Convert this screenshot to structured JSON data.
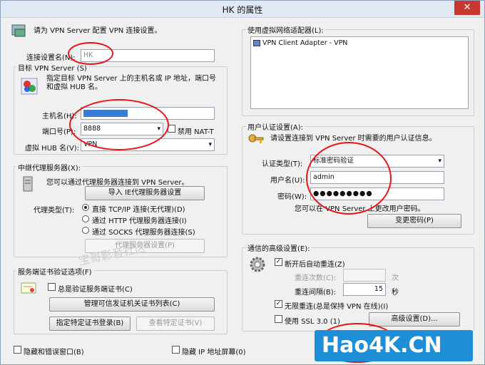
{
  "window": {
    "title": "HK 的属性",
    "close_label": "✕"
  },
  "intro": {
    "text": "请为 VPN Server 配置 VPN 连接设置。"
  },
  "connection": {
    "name_label": "连接设置名(N):",
    "name_value": "HK"
  },
  "target": {
    "group_label": "目标 VPN Server (S)",
    "desc": "指定目标 VPN Server 上的主机名或 IP 地址，端口号和虚拟 HUB 名。",
    "host_label": "主机名(H):",
    "port_label": "端口号(P):",
    "port_value": "8888",
    "nat_t_label": "禁用 NAT-T",
    "hub_label": "虚拟 HUB 名(V):",
    "hub_value": "VPN"
  },
  "proxy": {
    "group_label": "中继代理服务器(X):",
    "desc": "您可以通过代理服务器连接到 VPN Server。",
    "import_button": "导入 IE代理服务器设置",
    "type_label": "代理类型(T):",
    "options": [
      "直接 TCP/IP 连接(无代理)(D)",
      "通过 HTTP 代理服务器连接(I)",
      "通过 SOCKS 代理服务器连接(S)"
    ],
    "settings_button": "代理服务器设置(P)"
  },
  "cert": {
    "group_label": "服务端证书验证选项(F)",
    "verify_label": "总是验证服务端证书(C)",
    "manage_button": "管理可信发证机关证书列表(C)",
    "specify_button": "指定特定证书登录(B)",
    "view_button": "查看特定证书(V)"
  },
  "adapter": {
    "group_label": "使用虚拟网络适配器(L):",
    "item": "VPN Client Adapter - VPN"
  },
  "auth": {
    "group_label": "用户认证设置(A):",
    "desc": "请设置连接到 VPN Server 时需要的用户认证信息。",
    "type_label": "认证类型(T):",
    "type_value": "标准密码验证",
    "user_label": "用户名(U):",
    "user_value": "admin",
    "pass_label": "密码(W):",
    "pass_value": "●●●●●●●●●",
    "hint": "您可以在 VPN Server 上更改用户密码。",
    "change_button": "变更密码(P)"
  },
  "advanced": {
    "group_label": "通信的高级设置(E):",
    "auto_reconnect": "断开后自动重连(Z)",
    "retry_label": "重连次数(C):",
    "retry_unit": "次",
    "interval_label": "重连间隔(B):",
    "interval_value": "15",
    "interval_unit": "秒",
    "infinite": "无限重连(总是保持 VPN 在线)(I)",
    "ssl_label": "使用 SSL 3.0 (1)",
    "settings_button": "高级设置(D)..."
  },
  "bottom": {
    "hide_status": "隐藏和错误窗口(B)",
    "hide_ip": "隐藏 IP 地址屏幕(0)"
  },
  "watermark": "宝哥影音社区",
  "logo_text": "Hao4K.CN",
  "colors": {
    "annotation_red": "#e3161b",
    "logo_blue": "#1e8fd6",
    "selection_blue": "#3a7bd5"
  }
}
